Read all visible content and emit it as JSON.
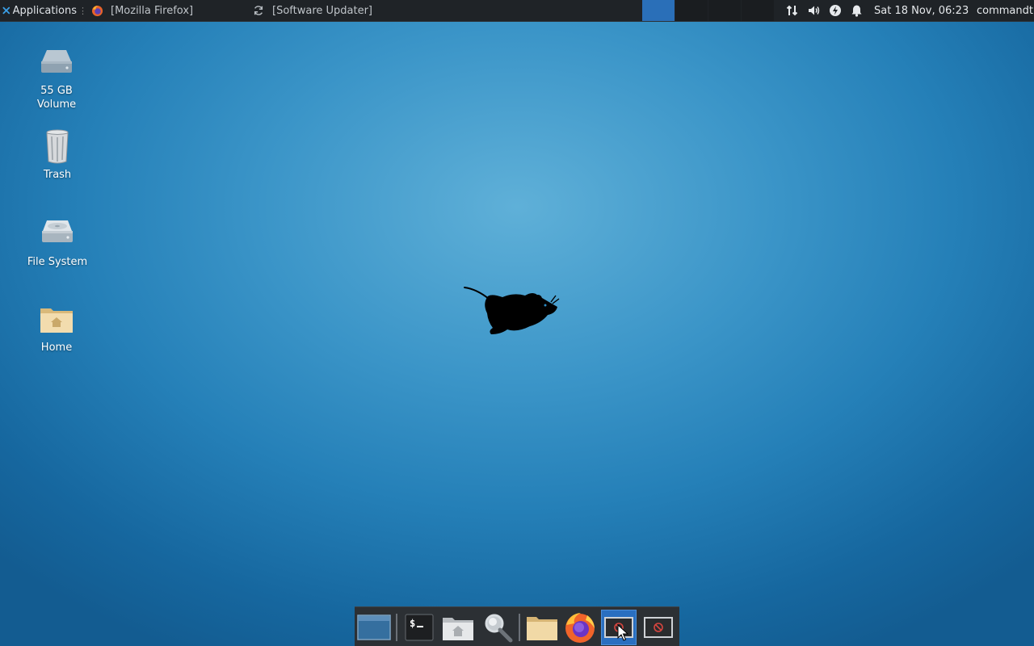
{
  "top_panel": {
    "applications_label": "Applications",
    "tasks": [
      {
        "label": "[Mozilla Firefox]",
        "icon": "firefox-icon"
      },
      {
        "label": "[Software Updater]",
        "icon": "refresh-icon"
      }
    ],
    "workspaces": 4,
    "active_workspace": 1,
    "tray_icons": [
      "network-icon",
      "volume-icon",
      "power-icon",
      "notification-bell-icon"
    ],
    "clock": "Sat 18 Nov, 06:23",
    "user": "commandt"
  },
  "desktop": {
    "icons": [
      {
        "label": "55 GB\nVolume",
        "icon": "drive-icon"
      },
      {
        "label": "Trash",
        "icon": "trash-icon"
      },
      {
        "label": "File System",
        "icon": "hard-disk-icon"
      },
      {
        "label": "Home",
        "icon": "home-folder-icon"
      }
    ]
  },
  "dock": {
    "items": [
      "show-desktop-icon",
      "terminal-icon",
      "home-folder-icon",
      "search-icon",
      "file-manager-icon",
      "firefox-icon",
      "window-icon",
      "window-icon"
    ],
    "terminal_glyph": "$_"
  },
  "colors": {
    "panel_bg": "#1f2327",
    "workspace_active": "#2a6fb8",
    "desktop_center": "#5fb0d8",
    "desktop_edge": "#135c91"
  }
}
